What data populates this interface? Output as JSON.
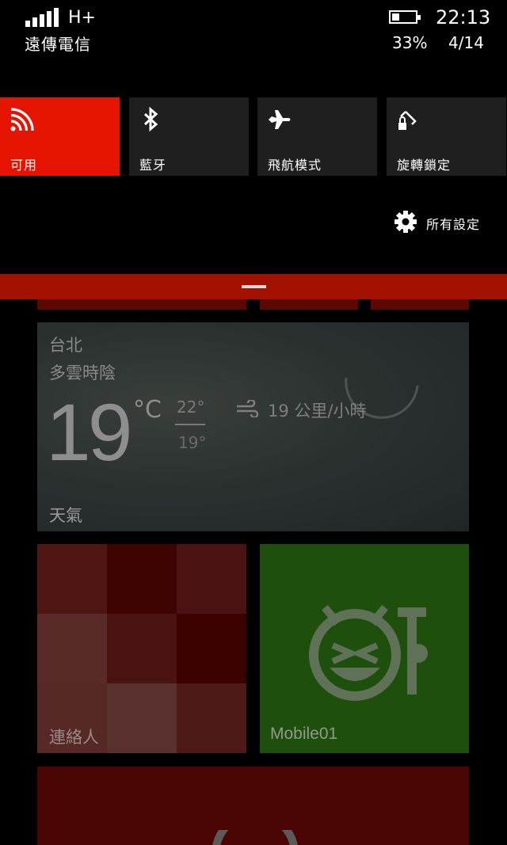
{
  "status_bar": {
    "network_type": "H+",
    "carrier": "遠傳電信",
    "time": "22:13",
    "battery_percent": "33%",
    "battery_level": 0.33,
    "date": "4/14"
  },
  "quick_actions": [
    {
      "label": "可用",
      "icon": "wifi-icon",
      "active": true
    },
    {
      "label": "藍牙",
      "icon": "bluetooth-icon",
      "active": false
    },
    {
      "label": "飛航模式",
      "icon": "airplane-icon",
      "active": false
    },
    {
      "label": "旋轉鎖定",
      "icon": "rotation-lock-icon",
      "active": false
    }
  ],
  "all_settings": {
    "label": "所有設定",
    "icon": "gear-icon"
  },
  "colors": {
    "accent": "#e51400",
    "tile_bg": "#1f1f1f",
    "drag_bar": "#a31100"
  },
  "weather_tile": {
    "city": "台北",
    "condition": "多雲時陰",
    "temperature": "19",
    "unit": "°C",
    "high": "22°",
    "low": "19°",
    "wind": "19 公里/小時",
    "name": "天氣"
  },
  "contacts_tile": {
    "name": "連絡人"
  },
  "mobile01_tile": {
    "name": "Mobile01"
  }
}
